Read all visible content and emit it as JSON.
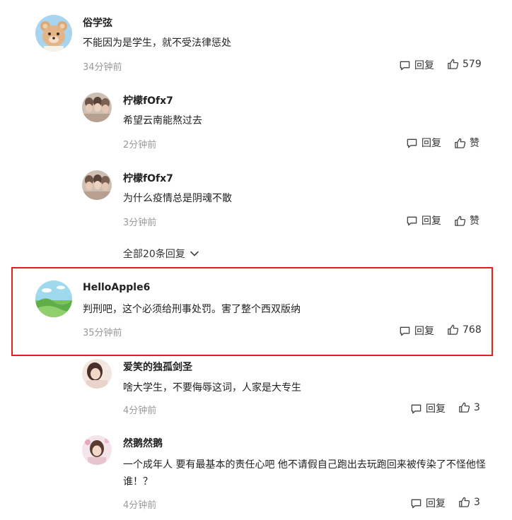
{
  "comments": [
    {
      "name": "俗学弦",
      "text": "不能因为是学生，就不受法律惩处",
      "time": "34分钟前",
      "reply_label": "回复",
      "like_label": "579",
      "avatar_icon": "bear-avatar"
    },
    {
      "name": "柠檬fOfx7",
      "text": "希望云南能熬过去",
      "time": "2分钟前",
      "reply_label": "回复",
      "like_label": "赞",
      "avatar_icon": "photo-avatar"
    },
    {
      "name": "柠檬fOfx7",
      "text": "为什么疫情总是阴魂不散",
      "time": "3分钟前",
      "reply_label": "回复",
      "like_label": "赞",
      "avatar_icon": "photo-avatar"
    },
    {
      "name": "HelloApple6",
      "text": "判刑吧，这个必须给刑事处罚。害了整个西双版纳",
      "time": "35分钟前",
      "reply_label": "回复",
      "like_label": "768",
      "avatar_icon": "landscape-avatar"
    },
    {
      "name": "爱笑的独孤剑圣",
      "text": "啥大学生，不要侮辱这词，人家是大专生",
      "time": "4分钟前",
      "reply_label": "回复",
      "like_label": "3",
      "avatar_icon": "photo-avatar"
    },
    {
      "name": "然鹅然鹅",
      "text": "一个成年人 要有最基本的责任心吧 他不请假自己跑出去玩跑回来被传染了不怪他怪谁！？",
      "time": "4分钟前",
      "reply_label": "回复",
      "like_label": "3",
      "avatar_icon": "photo-avatar"
    }
  ],
  "more_replies": "全部20条回复",
  "colors": {
    "highlight_border": "#e0201a",
    "time_gray": "#999999"
  }
}
